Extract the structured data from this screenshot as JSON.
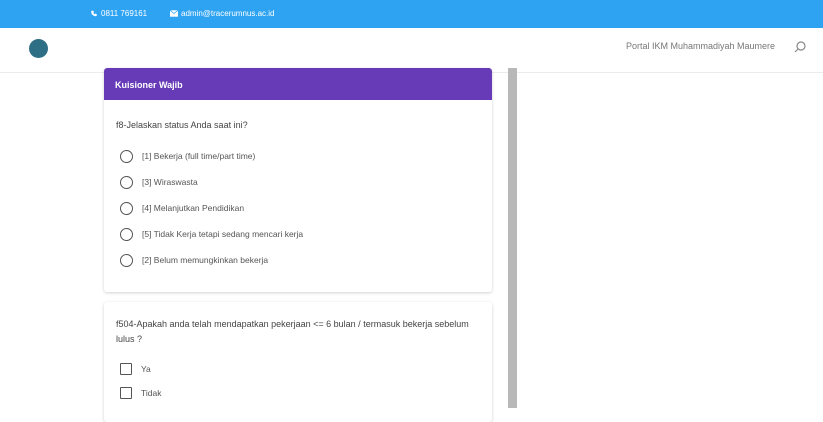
{
  "topbar": {
    "phone": "0811 769161",
    "email": "admin@tracerumnus.ac.id",
    "accent": "#2ea3f2"
  },
  "header": {
    "site_title": "Portal IKM Muhammadiyah Maumere"
  },
  "form": {
    "section_title": "Kuisioner Wajib",
    "header_color": "#673ab7",
    "q1": {
      "text": "f8-Jelaskan status Anda saat ini?",
      "options": [
        "[1] Bekerja (full time/part time)",
        "[3] Wiraswasta",
        "[4] Melanjutkan Pendidikan",
        "[5] Tidak Kerja tetapi sedang mencari kerja",
        "[2] Belum memungkinkan bekerja"
      ]
    },
    "q2": {
      "text": "f504-Apakah anda telah mendapatkan pekerjaan <= 6 bulan / termasuk bekerja sebelum lulus ?",
      "options": [
        "Ya",
        "Tidak"
      ]
    }
  }
}
